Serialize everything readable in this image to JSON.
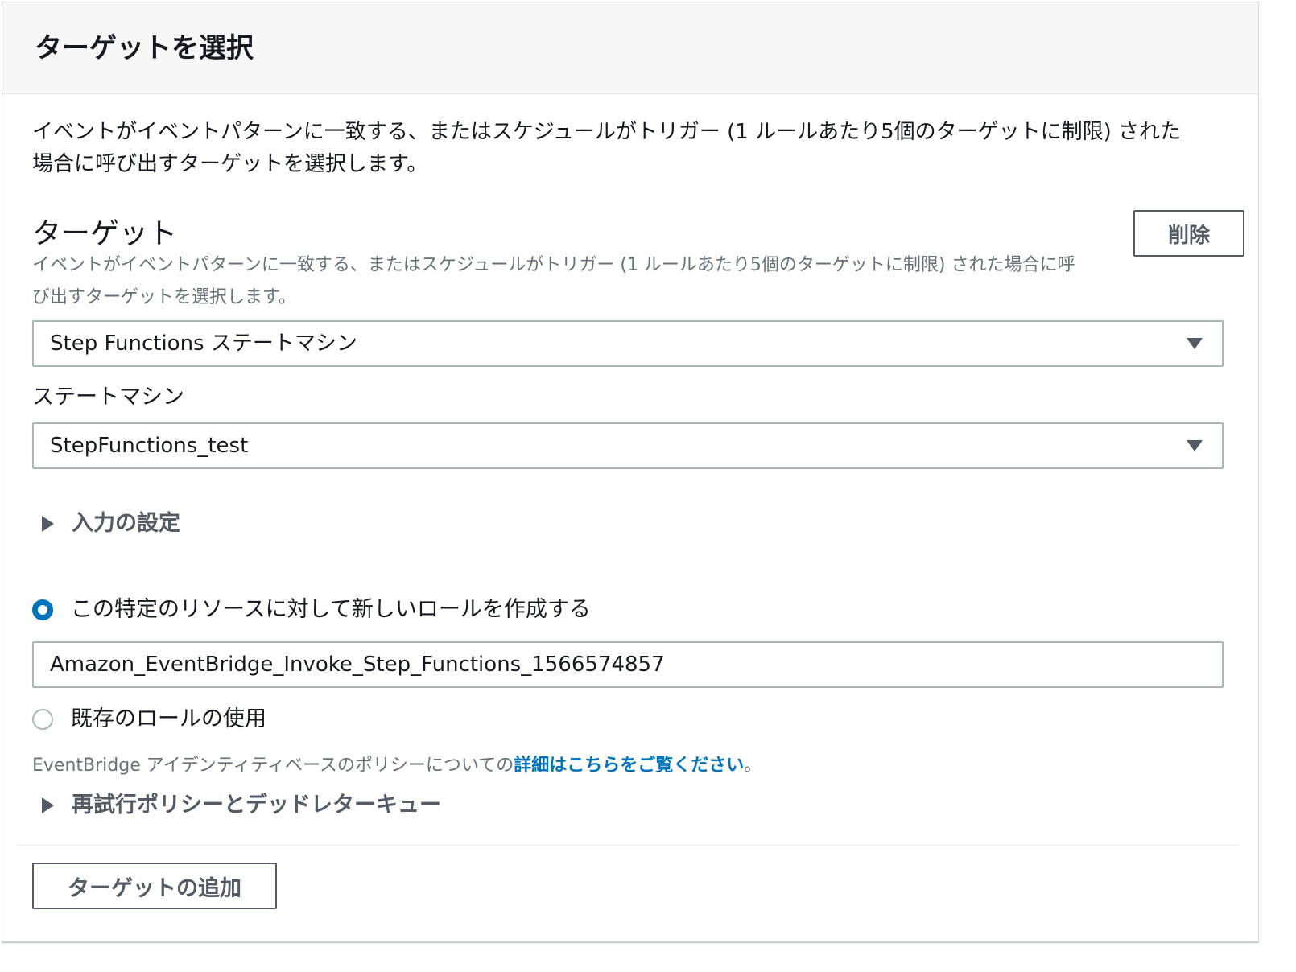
{
  "panel": {
    "title": "ターゲットを選択",
    "intro_line1": "イベントがイベントパターンに一致する、またはスケジュールがトリガー (1 ルールあたり5個のターゲットに制限) された",
    "intro_line2": "場合に呼び出すターゲットを選択します。"
  },
  "target": {
    "heading": "ターゲット",
    "description_line1": "イベントがイベントパターンに一致する、またはスケジュールがトリガー (1 ルールあたり5個のターゲットに制限) された場合に呼",
    "description_line2": "び出すターゲットを選択します。",
    "delete_label": "削除",
    "type_select_value": "Step Functions ステートマシン",
    "state_machine_label": "ステートマシン",
    "state_machine_value": "StepFunctions_test",
    "input_settings_label": "入力の設定",
    "role_new_label": "この特定のリソースに対して新しいロールを作成する",
    "role_new_selected": true,
    "role_name_value": "Amazon_EventBridge_Invoke_Step_Functions_1566574857",
    "role_existing_label": "既存のロールの使用",
    "help_text_prefix": "EventBridge アイデンティティベースのポリシーについての",
    "help_link_text": "詳細はこちらをご覧ください",
    "help_text_suffix": "。",
    "retry_policy_label": "再試行ポリシーとデッドレターキュー"
  },
  "footer": {
    "add_target_label": "ターゲットの追加"
  },
  "colors": {
    "accent": "#0073bb",
    "text": "#16191f",
    "secondary_text": "#687078",
    "border": "#aab7b8",
    "button_text": "#545b64"
  }
}
